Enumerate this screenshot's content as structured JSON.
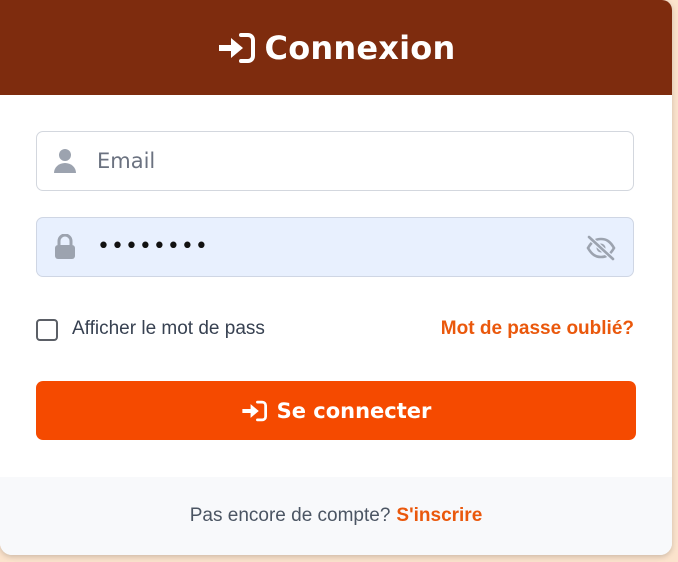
{
  "header": {
    "title": "Connexion",
    "icon": "sign-in-icon"
  },
  "form": {
    "email": {
      "placeholder": "Email",
      "icon": "user-icon"
    },
    "password": {
      "value": "••••••••",
      "icon": "lock-icon",
      "toggle_icon": "eye-slash-icon"
    },
    "show_password_label": "Afficher le mot de pass",
    "show_password_checked": false,
    "forgot_link": "Mot de passe oublié?",
    "submit_label": "Se connecter"
  },
  "footer": {
    "question": "Pas encore de compte?",
    "signup_link": "S'inscrire"
  },
  "colors": {
    "header_bg": "#7e2c0e",
    "accent": "#f54a00",
    "link": "#ea580c",
    "password_field_bg": "#e8f0fe"
  }
}
